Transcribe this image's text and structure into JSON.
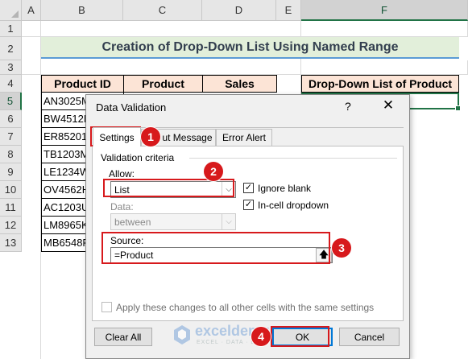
{
  "columns": [
    "A",
    "B",
    "C",
    "D",
    "E",
    "F"
  ],
  "rows": [
    "1",
    "2",
    "3",
    "4",
    "5",
    "6",
    "7",
    "8",
    "9",
    "10",
    "11",
    "12",
    "13"
  ],
  "selected_column": "F",
  "selected_row": "5",
  "sheet_title": "Creation of Drop-Down List Using Named Range",
  "table": {
    "headers": [
      "Product ID",
      "Product",
      "Sales"
    ],
    "product_ids": [
      "AN3025M",
      "BW4512R",
      "ER85201T",
      "TB1203M",
      "LE1234W",
      "OV4562H",
      "AC1203U",
      "LM8965K",
      "MB6548R"
    ]
  },
  "dropdown_header": "Drop-Down List of Product",
  "dialog": {
    "title": "Data Validation",
    "help": "?",
    "close": "✕",
    "tabs": [
      "Settings",
      "Input Message",
      "Error Alert"
    ],
    "tab_input_visible": "ut Message",
    "group_label": "Validation criteria",
    "allow_label": "Allow:",
    "allow_value": "List",
    "data_label": "Data:",
    "data_value": "between",
    "ignore_blank_label": "Ignore blank",
    "ignore_blank_checked": true,
    "in_cell_dropdown_label": "In-cell dropdown",
    "in_cell_dropdown_checked": true,
    "source_label": "Source:",
    "source_value": "=Product",
    "apply_all_label": "Apply these changes to all other cells with the same settings",
    "apply_all_checked": false,
    "clear_all": "Clear All",
    "ok": "OK",
    "cancel": "Cancel"
  },
  "annotations": [
    "1",
    "2",
    "3",
    "4"
  ],
  "watermark": {
    "name": "exceldemy",
    "tagline": "EXCEL · DATA · BI"
  },
  "colors": {
    "accent_green": "#217346",
    "annotation_red": "#d7191c",
    "title_fill": "#e2efda",
    "header_fill": "#fce4d6",
    "title_underline": "#5b9bd5",
    "default_button": "#0078d7"
  }
}
